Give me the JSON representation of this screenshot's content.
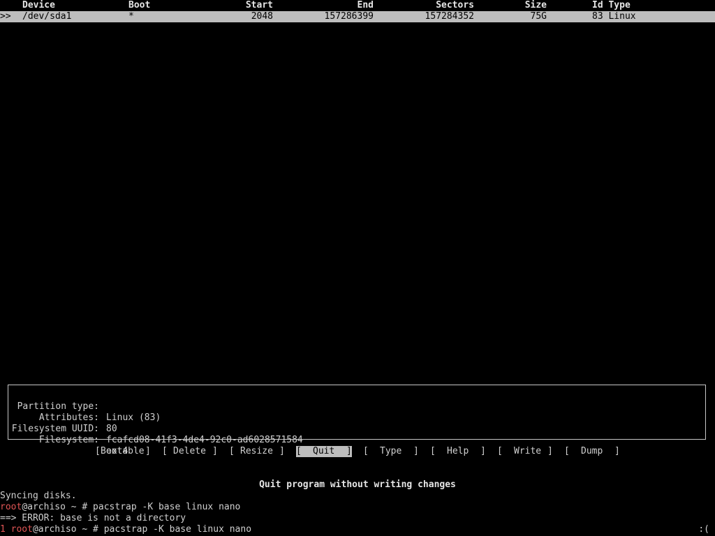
{
  "table": {
    "headers": {
      "device": "Device",
      "boot": "Boot",
      "start": "Start",
      "end": "End",
      "sectors": "Sectors",
      "size": "Size",
      "id_type": "Id Type"
    },
    "rows": [
      {
        "marker": ">>",
        "device": "/dev/sda1",
        "boot": "*",
        "start": "2048",
        "end": "157286399",
        "sectors": "157284352",
        "size": "75G",
        "id_type": "83 Linux"
      }
    ]
  },
  "info": {
    "partition_type_label": "Partition type:",
    "partition_type_value": "Linux (83)",
    "attributes_label": "Attributes:",
    "attributes_value": "80",
    "uuid_label": "Filesystem UUID:",
    "uuid_value": "fcafcd08-41f3-4de4-92c0-ad6028571584",
    "filesystem_label": "Filesystem:",
    "filesystem_value": "ext4"
  },
  "menu": {
    "items": [
      {
        "label": "Bootable",
        "active": false
      },
      {
        "label": "Delete",
        "active": false
      },
      {
        "label": "Resize",
        "active": false
      },
      {
        "label": "Quit",
        "active": true
      },
      {
        "label": "Type",
        "active": false
      },
      {
        "label": "Help",
        "active": false
      },
      {
        "label": "Write",
        "active": false
      },
      {
        "label": "Dump",
        "active": false
      }
    ]
  },
  "status_message": "Quit program without writing changes",
  "terminal": {
    "line1": "Syncing disks.",
    "line2_user": "root",
    "line2_rest": "@archiso ~ # pacstrap -K base linux nano",
    "line3": "==> ERROR: base is not a directory",
    "line4_exit": "1 root",
    "line4_rest": "@archiso ~ # pacstrap -K base linux nano",
    "line4_status": ":("
  },
  "colors": {
    "background": "#000000",
    "foreground": "#d0d0d0",
    "highlight": "#bdbdbd",
    "prompt_user": "#e05555"
  }
}
